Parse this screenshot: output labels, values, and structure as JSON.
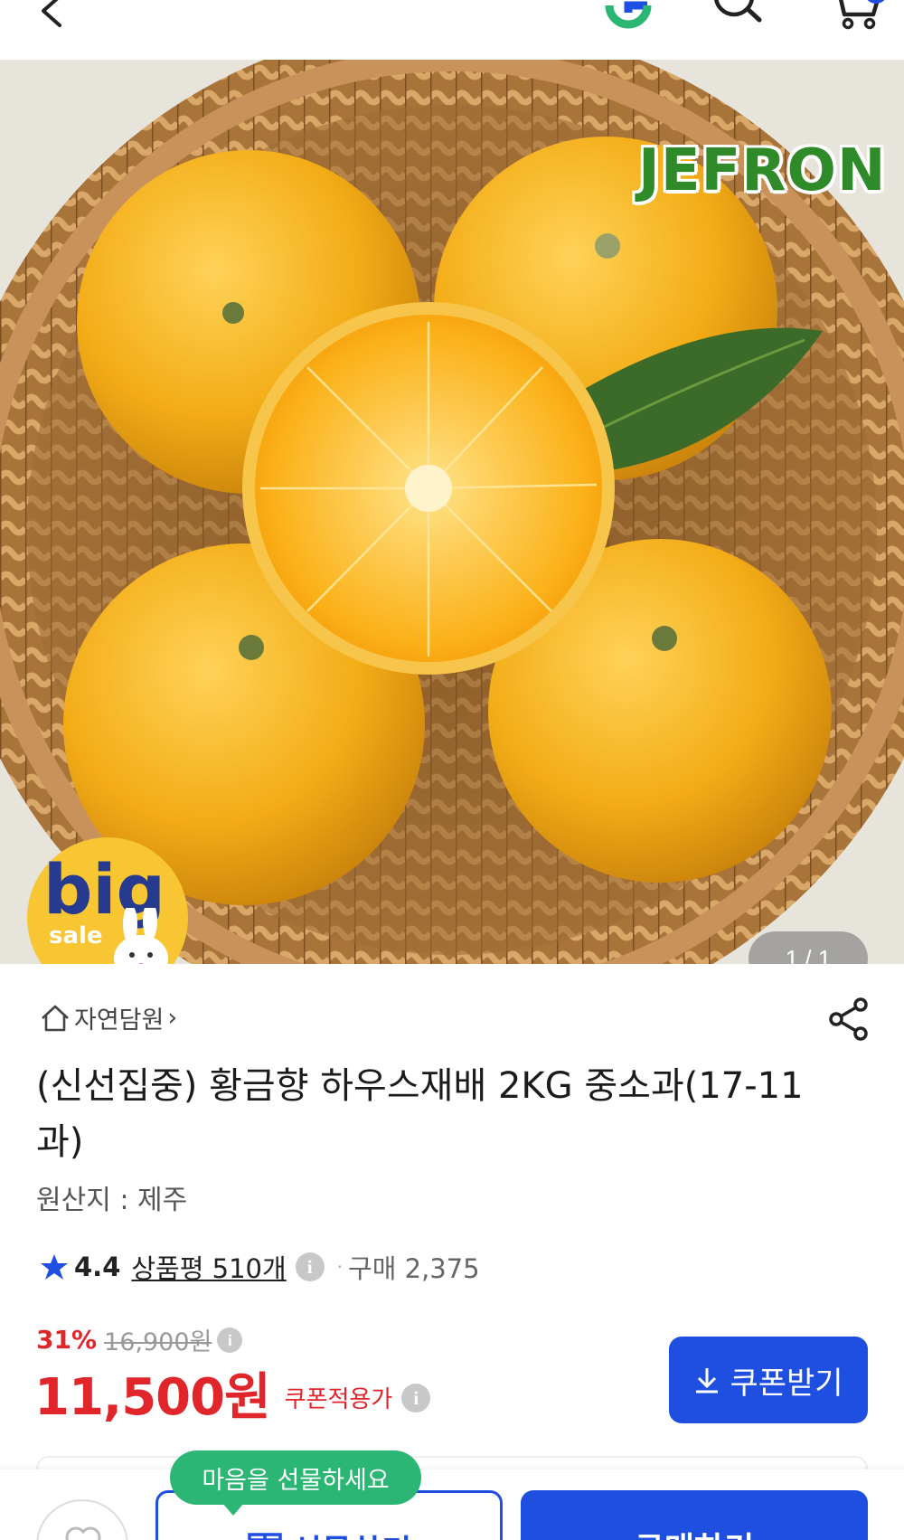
{
  "nav": {
    "back_icon": "chevron-left-icon",
    "logo_icon": "g-logo-icon",
    "search_icon": "search-icon",
    "cart_icon": "cart-icon",
    "accent": "#1f4fe0"
  },
  "hero": {
    "brand_logo": "JEFRON",
    "badge_big": "big",
    "badge_sale": "sale",
    "image_counter": "1 / 1"
  },
  "product": {
    "store_name": "자연담원",
    "store_chevron": "›",
    "title": "(신선집중) 황금향 하우스재배 2KG 중소과(17-11과)",
    "origin": "원산지 : 제주",
    "rating": "4.4",
    "reviews": "상품평 510개",
    "purchases": "구매 2,375",
    "discount_pct": "31%",
    "original_price": "16,900원",
    "price": "11,500원",
    "price_note": "쿠폰적용가",
    "coupon_button": "쿠폰받기",
    "info_glyph": "i",
    "sep": "·"
  },
  "bottom": {
    "tooltip": "마음을 선물하세요",
    "gift_button": "선물하기",
    "buy_button": "구매하기",
    "wish_icon": "heart-icon"
  },
  "colors": {
    "accent": "#1f4fe0",
    "sale_red": "#e0262b",
    "tooltip_green": "#2bb673",
    "star_blue": "#1f4fe0"
  }
}
